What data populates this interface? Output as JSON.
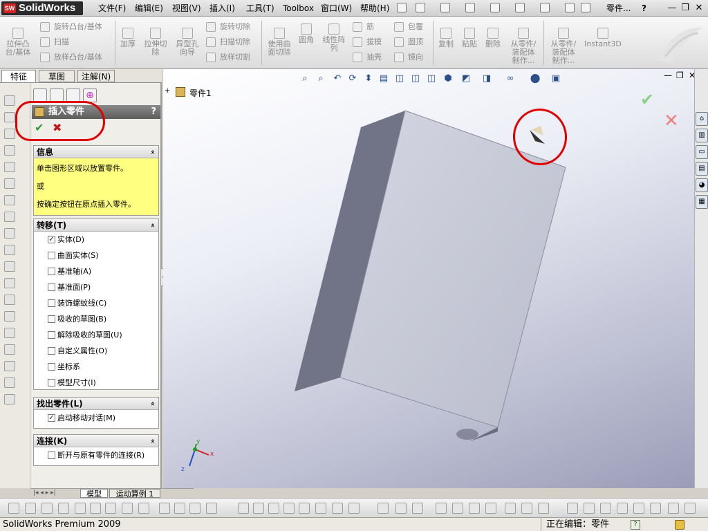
{
  "app": {
    "logo_text": "SolidWorks",
    "logo_badge": "SW"
  },
  "menus": [
    "文件(F)",
    "编辑(E)",
    "视图(V)",
    "插入(I)",
    "工具(T)",
    "Toolbox",
    "窗口(W)",
    "帮助(H)"
  ],
  "title_doc": "零件...",
  "title_help": "?",
  "window_buttons": {
    "minimize": "—",
    "restore": "❐",
    "close": "✕"
  },
  "command_manager": {
    "extrude_boss": "拉伸凸\n台/基体",
    "revolve_boss": "旋转凸台/基体",
    "sweep": "扫描",
    "loft_boss": "放样凸台/基体",
    "thicken": "加厚",
    "extrude_cut": "拉伸切\n除",
    "hole_wizard": "异型孔\n向导",
    "revolve_cut": "旋转切除",
    "sweep_cut": "扫描切除",
    "loft_cut": "放样切割",
    "surface_cut": "使用曲\n面切除",
    "fillet": "圆角",
    "linear_pattern": "线性阵\n列",
    "rib": "筋",
    "draft": "拔模",
    "shell": "抽壳",
    "wrap": "包覆",
    "dome": "圆顶",
    "mirror": "镜向",
    "copy": "复制",
    "paste": "粘贴",
    "delete": "删除",
    "from_part": "从零件/\n装配体\n制作...",
    "from_part2": "从零件/\n装配体\n制作...",
    "instant3d": "Instant3D"
  },
  "tabs": [
    {
      "label": "特征"
    },
    {
      "label": "草图"
    },
    {
      "label": "注解(N)"
    }
  ],
  "property_manager": {
    "title": "插入零件",
    "help": "?",
    "ok": "✔",
    "cancel": "✖",
    "info": {
      "header": "信息",
      "lines": [
        "单击图形区域以放置零件。",
        "或",
        "按确定按钮在原点插入零件。"
      ]
    },
    "transfer": {
      "header": "转移(T)",
      "items": [
        {
          "label": "实体(D)",
          "checked": true
        },
        {
          "label": "曲面实体(S)",
          "checked": false
        },
        {
          "label": "基准轴(A)",
          "checked": false
        },
        {
          "label": "基准面(P)",
          "checked": false
        },
        {
          "label": "装饰螺蚊线(C)",
          "checked": false
        },
        {
          "label": "吸收的草图(B)",
          "checked": false
        },
        {
          "label": "解除吸收的草图(U)",
          "checked": false
        },
        {
          "label": "自定义属性(O)",
          "checked": false
        },
        {
          "label": "坐标系",
          "checked": false
        },
        {
          "label": "模型尺寸(I)",
          "checked": false
        }
      ]
    },
    "locate": {
      "header": "找出零件(L)",
      "items": [
        {
          "label": "启动移动对话(M)",
          "checked": true
        }
      ]
    },
    "link": {
      "header": "连接(K)",
      "items": [
        {
          "label": "断开与原有零件的连接(R)",
          "checked": false
        }
      ]
    },
    "chevron": "«"
  },
  "tree": {
    "expander": "+",
    "label": "零件1"
  },
  "bottom_tabs": {
    "model": "模型",
    "motion": "运动算例 1"
  },
  "status": {
    "product": "SolidWorks Premium 2009",
    "editing": "正在编辑：零件",
    "help_icon": "?"
  },
  "axes": {
    "x": "x",
    "y": "y",
    "z": "z"
  },
  "colors": {
    "part_front": "#c7cad7",
    "part_side": "#6e7285",
    "annotation": "#e00000",
    "info_bg": "#ffff80"
  }
}
